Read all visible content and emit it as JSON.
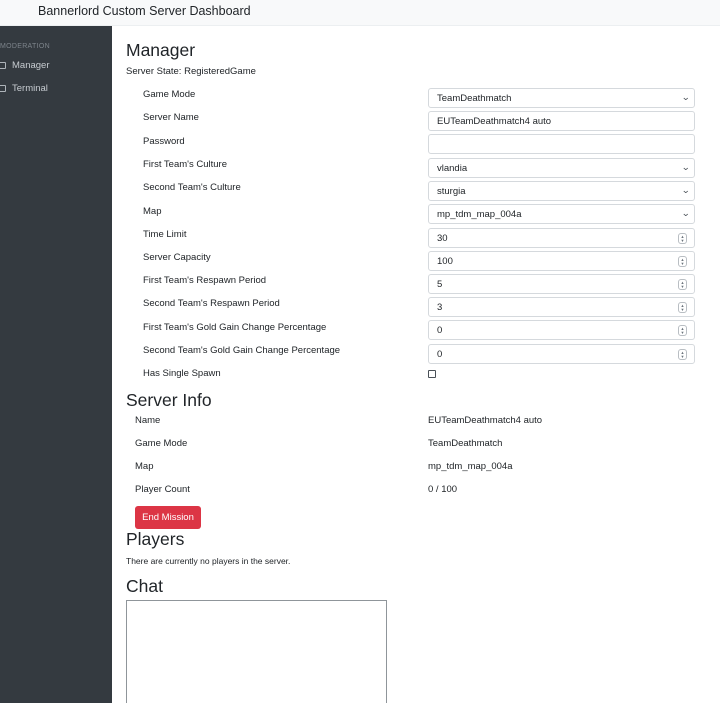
{
  "app": {
    "title": "Bannerlord Custom Server Dashboard"
  },
  "sidebar": {
    "heading": "MODERATION",
    "items": [
      {
        "label": "Manager",
        "icon": "square-icon"
      },
      {
        "label": "Terminal",
        "icon": "square-icon"
      }
    ]
  },
  "manager": {
    "title": "Manager",
    "server_state_label": "Server State:",
    "server_state_value": "RegisteredGame",
    "fields": [
      {
        "label": "Game Mode",
        "type": "select",
        "value": "TeamDeathmatch"
      },
      {
        "label": "Server Name",
        "type": "text",
        "value": "EUTeamDeathmatch4 auto"
      },
      {
        "label": "Password",
        "type": "text",
        "value": ""
      },
      {
        "label": "First Team's Culture",
        "type": "select",
        "value": "vlandia"
      },
      {
        "label": "Second Team's Culture",
        "type": "select",
        "value": "sturgia"
      },
      {
        "label": "Map",
        "type": "select",
        "value": "mp_tdm_map_004a"
      },
      {
        "label": "Time Limit",
        "type": "number",
        "value": "30"
      },
      {
        "label": "Server Capacity",
        "type": "number",
        "value": "100"
      },
      {
        "label": "First Team's Respawn Period",
        "type": "number",
        "value": "5"
      },
      {
        "label": "Second Team's Respawn Period",
        "type": "number",
        "value": "3"
      },
      {
        "label": "First Team's Gold Gain Change Percentage",
        "type": "number",
        "value": "0"
      },
      {
        "label": "Second Team's Gold Gain Change Percentage",
        "type": "number",
        "value": "0"
      },
      {
        "label": "Has Single Spawn",
        "type": "checkbox",
        "checked": false
      }
    ]
  },
  "server_info": {
    "title": "Server Info",
    "rows": [
      {
        "label": "Name",
        "value": "EUTeamDeathmatch4 auto"
      },
      {
        "label": "Game Mode",
        "value": "TeamDeathmatch"
      },
      {
        "label": "Map",
        "value": "mp_tdm_map_004a"
      },
      {
        "label": "Player Count",
        "value": "0 / 100"
      }
    ],
    "end_mission_label": "End Mission"
  },
  "players": {
    "title": "Players",
    "empty_message": "There are currently no players in the server."
  },
  "chat": {
    "title": "Chat"
  },
  "colors": {
    "sidebar_bg": "#343a40",
    "topbar_bg": "#f8f9fa",
    "danger": "#dc3545"
  }
}
